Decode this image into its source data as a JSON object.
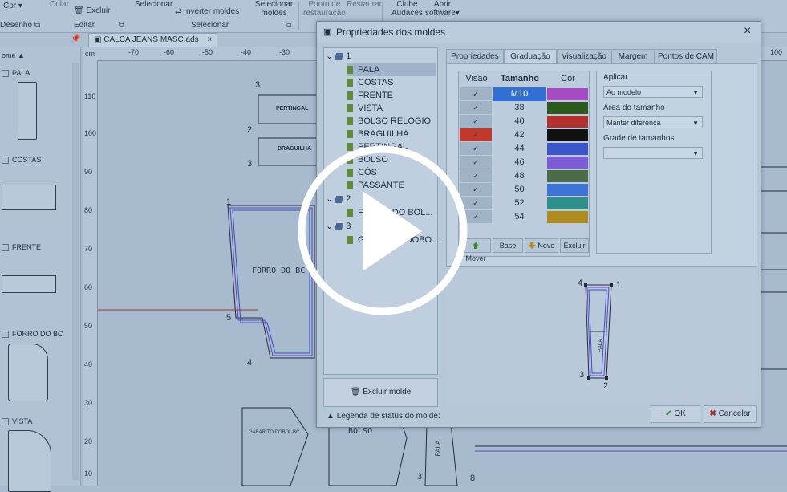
{
  "ribbon": {
    "color_label": "Cor",
    "colar_label": "Colar",
    "excluir_label": "Excluir",
    "selecionar_top": "Selecionar",
    "inverter_label": "Inverter moldes",
    "selecionar_moldes_1": "Selecionar",
    "selecionar_moldes_2": "moldes",
    "ponto_1": "Ponto de",
    "ponto_2": "restauração",
    "restaurar_label": "Restaurar",
    "clube_1": "Clube",
    "clube_2": "Audaces",
    "abrir_1": "Abrir",
    "abrir_2": "software",
    "group_desenho": "Desenho",
    "group_editar": "Editar",
    "group_selecionar": "Selecionar"
  },
  "file_tab": {
    "name": "CALCA JEANS MASC.ads"
  },
  "left_panel": {
    "header": "ome",
    "items": [
      "PALA",
      "COSTAS",
      "FRENTE",
      "FORRO DO BC",
      "VISTA"
    ]
  },
  "ruler": {
    "unit": "cm",
    "h_ticks": [
      "-70",
      "-60",
      "-50",
      "-40",
      "-30",
      "100"
    ],
    "v_ticks": [
      "110",
      "100",
      "90",
      "80",
      "70",
      "60",
      "50",
      "40",
      "30",
      "20",
      "10"
    ]
  },
  "canvas": {
    "labels": [
      "PERTINGAL",
      "BRAGUILHA",
      "FORRO DO BC",
      "BOLSO",
      "PALA",
      "GABARITO DOBOL BC"
    ],
    "point_numbers": [
      "3",
      "2",
      "3",
      "1",
      "5",
      "4",
      "8",
      "3"
    ]
  },
  "dialog": {
    "title": "Propriedades dos moldes",
    "close_icon": "close-icon",
    "tree": {
      "group1": "1",
      "items": [
        "PALA",
        "COSTAS",
        "FRENTE",
        "VISTA",
        "BOLSO RELOGIO",
        "BRAGUILHA",
        "PERTINGAL",
        "BOLSO",
        "CÓS",
        "PASSANTE"
      ],
      "group2": "2",
      "group2_items": [
        "FORRO DO BOL..."
      ],
      "group3": "3",
      "group3_items": [
        "GABARITO DOBO..."
      ]
    },
    "excluir_molde": "Excluir molde",
    "legenda": "Legenda de status do molde:",
    "tabs": [
      "Propriedades",
      "Graduação",
      "Visualização",
      "Margem",
      "Pontos de CAM"
    ],
    "active_tab": "Graduação",
    "grid": {
      "headers": [
        "Visão",
        "Tamanho",
        "Cor"
      ],
      "rows": [
        {
          "size": "M10",
          "color": "#a64bc1"
        },
        {
          "size": "38",
          "color": "#2b5a1f"
        },
        {
          "size": "40",
          "color": "#b0302c"
        },
        {
          "size": "42",
          "color": "#111111"
        },
        {
          "size": "44",
          "color": "#3a55c9"
        },
        {
          "size": "46",
          "color": "#7e5bd6"
        },
        {
          "size": "48",
          "color": "#4a6a48"
        },
        {
          "size": "50",
          "color": "#3d74d8"
        },
        {
          "size": "52",
          "color": "#2f8f8a"
        },
        {
          "size": "54",
          "color": "#b08c1f"
        }
      ],
      "buttons": [
        "Mover",
        "Base",
        "Novo",
        "Excluir"
      ]
    },
    "aplicar": {
      "title": "Aplicar",
      "aplicar_value": "Ao modelo",
      "area_label": "Área do tamanho",
      "area_value": "Manter diferença",
      "grade_label": "Grade de tamanhos",
      "grade_value": ""
    },
    "preview": {
      "piece_label": "PALA",
      "points": [
        "4",
        "1",
        "3",
        "2"
      ]
    },
    "ok_label": "OK",
    "cancel_label": "Cancelar"
  },
  "colors": {
    "selected_row": "#2f6fd6",
    "accent_red": "#c0392b",
    "ok_check": "#3a8a3a",
    "cancel_x": "#b0302c"
  }
}
